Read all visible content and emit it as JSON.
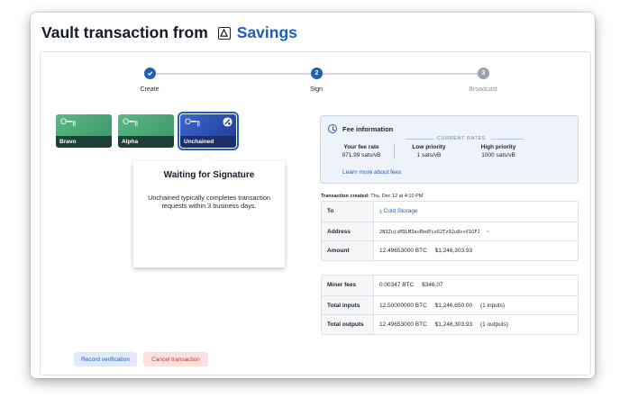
{
  "header": {
    "title": "Vault transaction from",
    "vault_name": "Savings",
    "vault_icon": "vault-icon"
  },
  "stepper": {
    "steps": [
      {
        "label": "Create",
        "number": "",
        "state": "done"
      },
      {
        "label": "Sign",
        "number": "2",
        "state": "active"
      },
      {
        "label": "Broadcast",
        "number": "3",
        "state": "pending"
      }
    ]
  },
  "keys": [
    {
      "name": "Bravo",
      "icon": "key-icon"
    },
    {
      "name": "Alpha",
      "icon": "key-icon"
    },
    {
      "name": "Unchained",
      "icon": "key-icon",
      "selected": true
    }
  ],
  "popup": {
    "title": "Waiting for Signature",
    "body": "Unchained typically completes transaction requests within 3 business days."
  },
  "fees": {
    "title": "Fee information",
    "rates_label": "CURRENT RATES",
    "your_rate_label": "Your fee rate",
    "your_rate_value": "971.99 sats/vB",
    "low_label": "Low priority",
    "low_value": "1 sats/vB",
    "high_label": "High priority",
    "high_value": "1000 sats/vB",
    "learn_more": "Learn more about fees"
  },
  "tx": {
    "created_label": "Transaction created:",
    "created_value": "Thu, Dec 12 at 4:10 PM",
    "to_label": "To",
    "to_value": "Cold Storage",
    "address_label": "Address",
    "address_value": "2N3ZujxM3LM3avRbdPix62Tz92u8xvV1GFJ",
    "amount_label": "Amount",
    "amount_btc": "12.49653000 BTC",
    "amount_usd": "$1,246,303.93",
    "miner_label": "Miner fees",
    "miner_btc": "0.00347 BTC",
    "miner_usd": "$346.07",
    "inputs_label": "Total inputs",
    "inputs_btc": "12.50000000 BTC",
    "inputs_usd": "$1,246,650.00",
    "inputs_count": "(1 inputs)",
    "outputs_label": "Total outputs",
    "outputs_btc": "12.49653000 BTC",
    "outputs_usd": "$1,246,303.93",
    "outputs_count": "(1 outputs)"
  },
  "actions": {
    "verify": "Record verification",
    "cancel": "Cancel transaction"
  },
  "colors": {
    "accent": "#1f5fb8",
    "key_green": "#4aa476",
    "key_blue": "#2a4fb0",
    "danger": "#c0392b"
  }
}
